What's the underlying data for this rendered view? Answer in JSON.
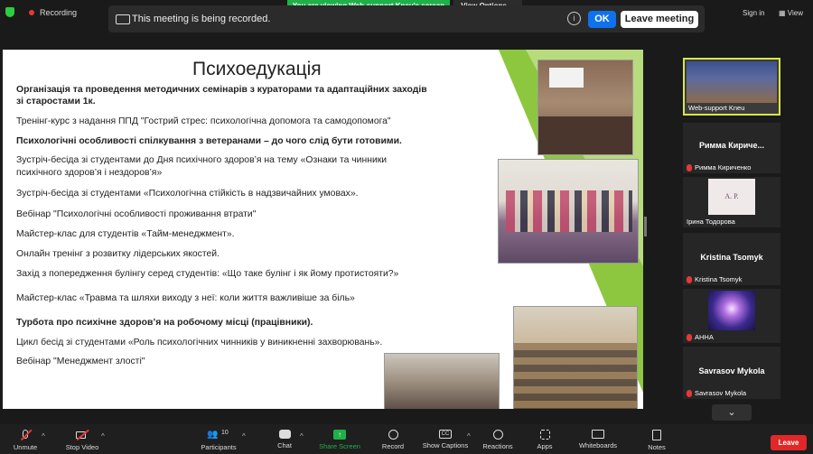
{
  "top": {
    "recording_label": "Recording",
    "viewing_banner": "You are viewing Web-support Kneu's screen",
    "view_options": "View Options",
    "recorded_message": "This meeting is being recorded.",
    "ok_label": "OK",
    "leave_meeting_label": "Leave meeting",
    "sign_in": "Sign in",
    "view": "View"
  },
  "slide": {
    "title": "Психоедукація",
    "lines": [
      "Організація та проведення методичних семінарів з кураторами та адаптаційних заходів",
      "зі старостами 1к.",
      "Тренінг-курс з надання ППД \"Гострий стрес: психологічна допомога та самодопомога\"",
      "Психологічні особливості спілкування з ветеранами – до чого слід бути готовими.",
      "Зустріч-бесіда зі студентами до Дня психічного здоров’я на тему «Ознаки та чинники",
      "психічного здоров’я і нездоров’я»",
      "Зустріч-бесіда зі студентами «Психологічна стійкість в надзвичайних умовах».",
      "Вебінар \"Психологічні особливості проживання втрати\"",
      "Майстер-клас для студентів «Тайм-менеджмент».",
      "Онлайн тренінг з розвитку лідерських якостей.",
      "Захід з попередження булінгу серед студентів: «Що таке булінг і як йому протистояти?»",
      "Майстер-клас «Травма та шляхи виходу з неї: коли життя важливіше за біль»",
      "Турбота про психічне здоров’я на робочому місці (працівники).",
      "Цикл бесід зі студентами «Роль психологічних чинників у виникненні захворювань».",
      "Вебінар \"Менеджмент злості\""
    ]
  },
  "participants": {
    "tile1_name": "Web-support Kneu",
    "tile2_big": "Римма Кириче...",
    "tile2_name": "Римма Кириченко",
    "tile3_initials": "А. Р.",
    "tile3_name": "Ірина Тодорова",
    "tile4_big": "Kristina Tsomyk",
    "tile4_name": "Kristina Tsomyk",
    "tile5_name": "АННА",
    "tile6_big": "Savrasov Mykola",
    "tile6_name": "Savrasov Mykola"
  },
  "toolbar": {
    "unmute": "Unmute",
    "stop_video": "Stop Video",
    "participants": "Participants",
    "participants_count": "10",
    "chat": "Chat",
    "share_screen": "Share Screen",
    "record": "Record",
    "show_captions": "Show Captions",
    "reactions": "Reactions",
    "apps": "Apps",
    "whiteboards": "Whiteboards",
    "notes": "Notes",
    "leave": "Leave"
  },
  "colors": {
    "accent_blue": "#0e72ed",
    "share_green": "#20b04b",
    "leave_red": "#e02828",
    "slide_green": "#8dc73f",
    "active_speaker": "#d9e64a"
  }
}
